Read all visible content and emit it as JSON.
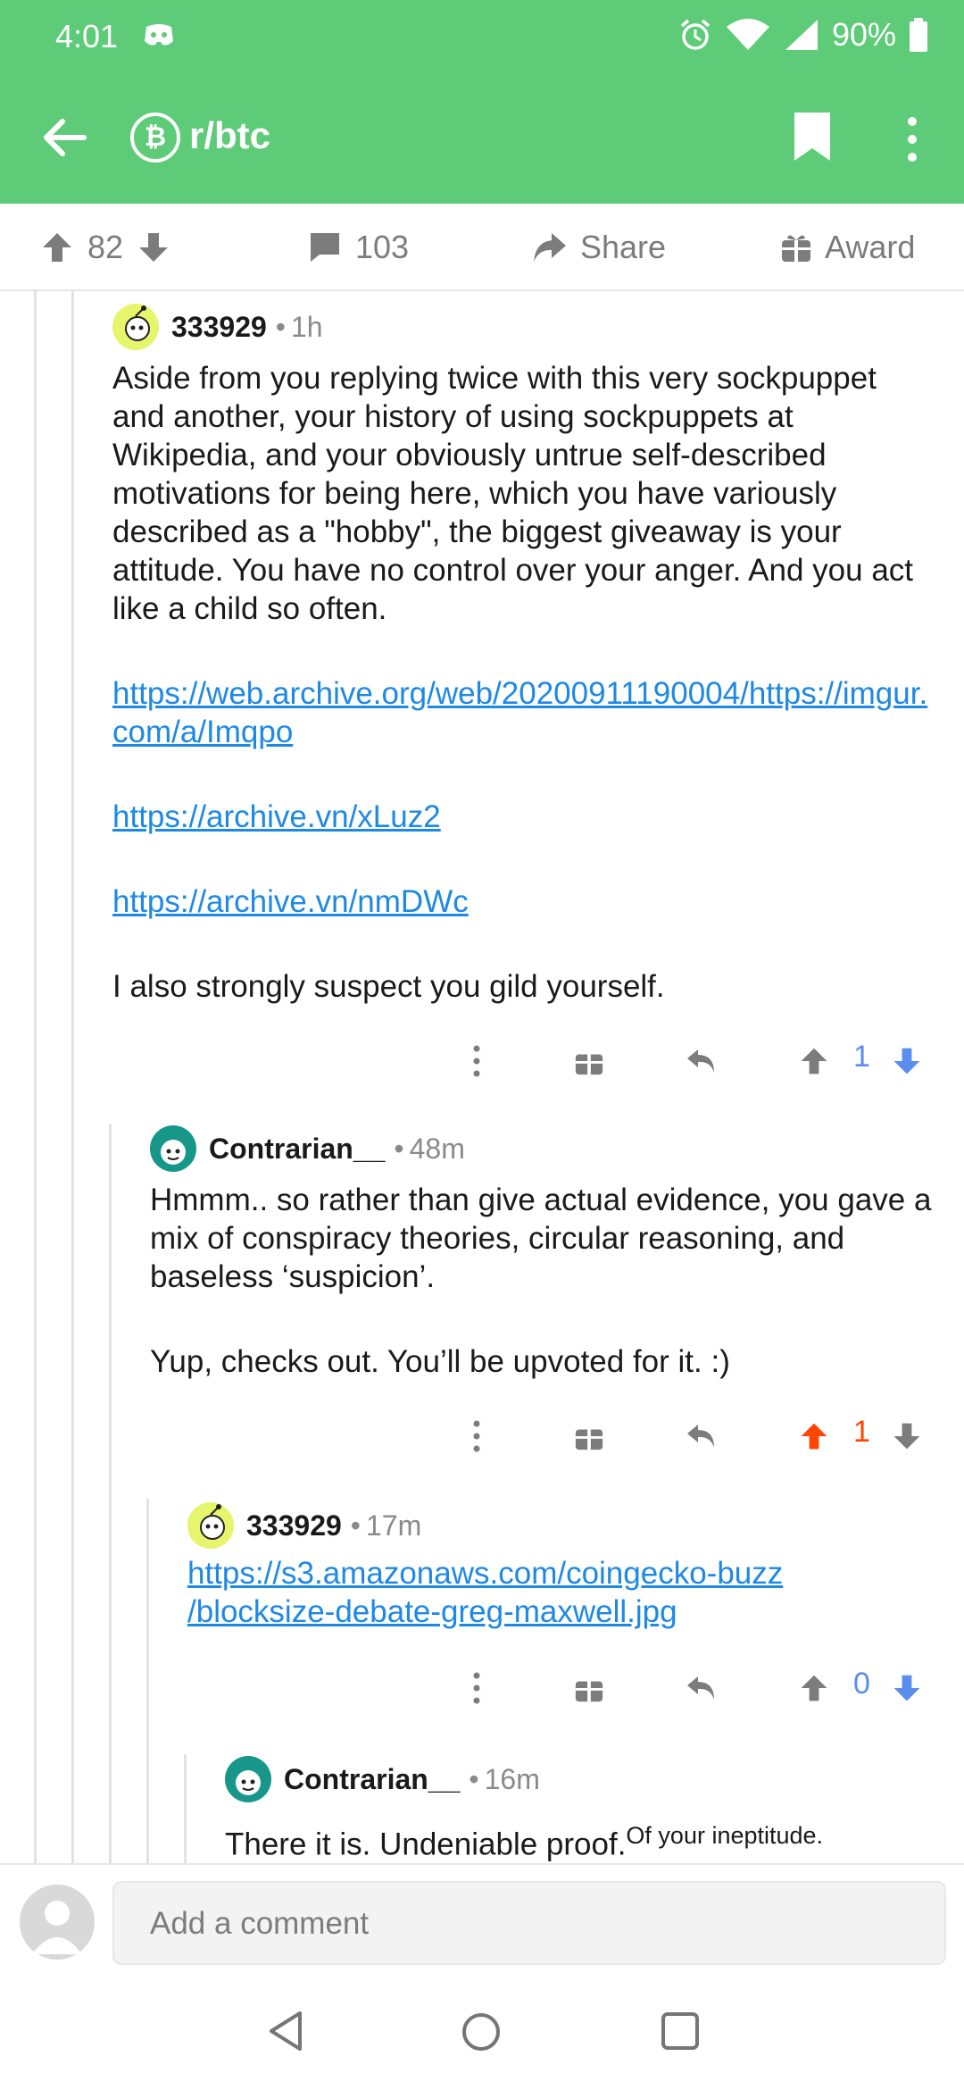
{
  "status": {
    "time": "4:01",
    "battery": "90%"
  },
  "toolbar": {
    "subreddit": "r/btc"
  },
  "post_actions": {
    "upvotes": "82",
    "comments": "103",
    "share": "Share",
    "award": "Award"
  },
  "comments": [
    {
      "author": "333929",
      "age": "1h",
      "paragraphs": [
        "Aside from you replying twice with this very sockpuppet and another, your history of using sockpuppets at Wikipedia, and your obviously untrue self-described motivations for being here, which you have variously described as a \"hobby\", the biggest giveaway is your attitude. You have no control over your anger. And you act like a child so often."
      ],
      "links": [
        "https://web.archive.org/web/20200911190004/https://imgur.com/a/Imqpo",
        "https://archive.vn/xLuz2",
        "https://archive.vn/nmDWc"
      ],
      "closing": "I also strongly suspect you gild yourself.",
      "score": "1"
    },
    {
      "author": "Contrarian__",
      "age": "48m",
      "paragraphs": [
        "Hmmm.. so rather than give actual evidence, you gave a mix of conspiracy theories, circular reasoning, and baseless ‘suspicion’.",
        "Yup, checks out. You’ll be upvoted for it. :)"
      ],
      "score": "1"
    },
    {
      "author": "333929",
      "age": "17m",
      "link": "https://s3.amazonaws.com/coingecko-buzz/blocksize-debate-greg-maxwell.jpg",
      "link_line1": "https://s3.amazonaws.com/coingecko-buzz",
      "link_line2": "/blocksize-debate-greg-maxwell.jpg",
      "score": "0"
    },
    {
      "author": "Contrarian__",
      "age": "16m",
      "text": "There it is. Undeniable proof.",
      "superscript": "Of your ineptitude."
    }
  ],
  "composer": {
    "placeholder": "Add a comment"
  },
  "colors": {
    "header": "#5ecb78",
    "link": "#1e88e5",
    "upvote_active": "#ff4500",
    "downvote_active": "#5b8def",
    "score_blue": "#5b8def"
  }
}
